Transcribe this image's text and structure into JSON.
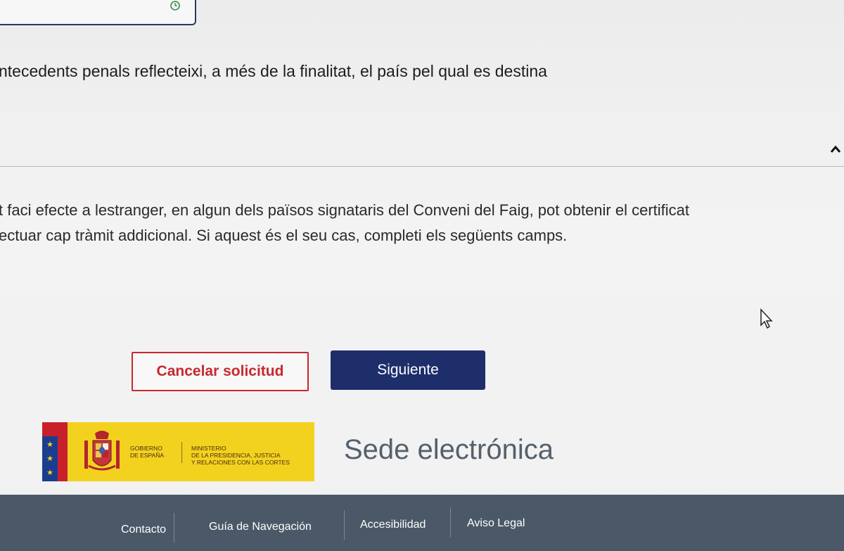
{
  "form": {
    "line_1": "ntecedents penals reflecteixi, a més de la finalitat, el país pel qual es destina",
    "paragraph_2_line_1": "t faci efecte a lestranger, en algun dels països signataris del Conveni del Faig, pot obtenir el certificat",
    "paragraph_2_line_2": "ectuar cap tràmit addicional. Si aquest és el seu cas, completi els següents camps."
  },
  "actions": {
    "cancel_label": "Cancelar solicitud",
    "next_label": "Siguiente"
  },
  "branding": {
    "gobierno_line_1": "Gobierno",
    "gobierno_line_2": "de España",
    "ministerio_line_1": "Ministerio",
    "ministerio_line_2": "de la Presidencia, Justicia",
    "ministerio_line_3": "y Relaciones con las Cortes",
    "site_title": "Sede electrónica"
  },
  "footer": {
    "links": [
      {
        "label": "Contacto"
      },
      {
        "label": "Guía de Navegación"
      },
      {
        "label": "Accesibilidad"
      },
      {
        "label": "Aviso Legal"
      }
    ]
  },
  "colors": {
    "primary_button": "#1d2e6b",
    "cancel_accent": "#c8282e",
    "footer_bg": "#4a5867",
    "logo_yellow": "#f2d21e"
  },
  "icons": {
    "top_box_icon": "refresh-icon",
    "section_toggle": "chevron-up-icon",
    "pointer": "cursor-icon",
    "coat_of_arms": "coat-of-arms-icon"
  }
}
